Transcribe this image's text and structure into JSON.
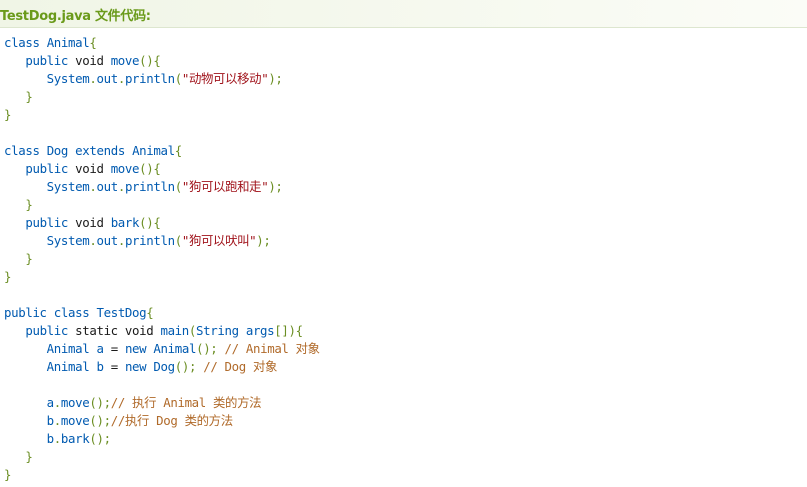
{
  "header": {
    "title": "TestDog.java 文件代码:"
  },
  "colors": {
    "keyword": "#005ab0",
    "plain": "#1a1a1a",
    "punctuation": "#6b8e23",
    "string": "#a0131b",
    "comment": "#b06a2a",
    "header_text": "#6a9a1a"
  },
  "code": {
    "lines": [
      [
        [
          "kw",
          "class"
        ],
        [
          "pl",
          " "
        ],
        [
          "kw",
          "Animal"
        ],
        [
          "pn",
          "{"
        ]
      ],
      [
        [
          "pl",
          "   "
        ],
        [
          "kw",
          "public"
        ],
        [
          "pl",
          " void "
        ],
        [
          "kw",
          "move"
        ],
        [
          "pn",
          "(){"
        ]
      ],
      [
        [
          "pl",
          "      "
        ],
        [
          "kw",
          "System"
        ],
        [
          "pn",
          "."
        ],
        [
          "kw",
          "out"
        ],
        [
          "pn",
          "."
        ],
        [
          "kw",
          "println"
        ],
        [
          "pn",
          "("
        ],
        [
          "st",
          "\"动物可以移动\""
        ],
        [
          "pn",
          ");"
        ]
      ],
      [
        [
          "pl",
          "   "
        ],
        [
          "pn",
          "}"
        ]
      ],
      [
        [
          "pn",
          "}"
        ]
      ],
      [],
      [
        [
          "kw",
          "class"
        ],
        [
          "pl",
          " "
        ],
        [
          "kw",
          "Dog"
        ],
        [
          "pl",
          " "
        ],
        [
          "kw",
          "extends"
        ],
        [
          "pl",
          " "
        ],
        [
          "kw",
          "Animal"
        ],
        [
          "pn",
          "{"
        ]
      ],
      [
        [
          "pl",
          "   "
        ],
        [
          "kw",
          "public"
        ],
        [
          "pl",
          " void "
        ],
        [
          "kw",
          "move"
        ],
        [
          "pn",
          "(){"
        ]
      ],
      [
        [
          "pl",
          "      "
        ],
        [
          "kw",
          "System"
        ],
        [
          "pn",
          "."
        ],
        [
          "kw",
          "out"
        ],
        [
          "pn",
          "."
        ],
        [
          "kw",
          "println"
        ],
        [
          "pn",
          "("
        ],
        [
          "st",
          "\"狗可以跑和走\""
        ],
        [
          "pn",
          ");"
        ]
      ],
      [
        [
          "pl",
          "   "
        ],
        [
          "pn",
          "}"
        ]
      ],
      [
        [
          "pl",
          "   "
        ],
        [
          "kw",
          "public"
        ],
        [
          "pl",
          " void "
        ],
        [
          "kw",
          "bark"
        ],
        [
          "pn",
          "(){"
        ]
      ],
      [
        [
          "pl",
          "      "
        ],
        [
          "kw",
          "System"
        ],
        [
          "pn",
          "."
        ],
        [
          "kw",
          "out"
        ],
        [
          "pn",
          "."
        ],
        [
          "kw",
          "println"
        ],
        [
          "pn",
          "("
        ],
        [
          "st",
          "\"狗可以吠叫\""
        ],
        [
          "pn",
          ");"
        ]
      ],
      [
        [
          "pl",
          "   "
        ],
        [
          "pn",
          "}"
        ]
      ],
      [
        [
          "pn",
          "}"
        ]
      ],
      [],
      [
        [
          "kw",
          "public"
        ],
        [
          "pl",
          " "
        ],
        [
          "kw",
          "class"
        ],
        [
          "pl",
          " "
        ],
        [
          "kw",
          "TestDog"
        ],
        [
          "pn",
          "{"
        ]
      ],
      [
        [
          "pl",
          "   "
        ],
        [
          "kw",
          "public"
        ],
        [
          "pl",
          " static void "
        ],
        [
          "kw",
          "main"
        ],
        [
          "pn",
          "("
        ],
        [
          "kw",
          "String"
        ],
        [
          "pl",
          " "
        ],
        [
          "kw",
          "args"
        ],
        [
          "pn",
          "[]){"
        ]
      ],
      [
        [
          "pl",
          "      "
        ],
        [
          "kw",
          "Animal"
        ],
        [
          "pl",
          " "
        ],
        [
          "kw",
          "a"
        ],
        [
          "pl",
          " = "
        ],
        [
          "kw",
          "new"
        ],
        [
          "pl",
          " "
        ],
        [
          "kw",
          "Animal"
        ],
        [
          "pn",
          "();"
        ],
        [
          "pl",
          " "
        ],
        [
          "cm",
          "// Animal 对象"
        ]
      ],
      [
        [
          "pl",
          "      "
        ],
        [
          "kw",
          "Animal"
        ],
        [
          "pl",
          " "
        ],
        [
          "kw",
          "b"
        ],
        [
          "pl",
          " = "
        ],
        [
          "kw",
          "new"
        ],
        [
          "pl",
          " "
        ],
        [
          "kw",
          "Dog"
        ],
        [
          "pn",
          "();"
        ],
        [
          "pl",
          " "
        ],
        [
          "cm",
          "// Dog 对象"
        ]
      ],
      [],
      [
        [
          "pl",
          "      "
        ],
        [
          "kw",
          "a"
        ],
        [
          "pn",
          "."
        ],
        [
          "kw",
          "move"
        ],
        [
          "pn",
          "();"
        ],
        [
          "cm",
          "// 执行 Animal 类的方法"
        ]
      ],
      [
        [
          "pl",
          "      "
        ],
        [
          "kw",
          "b"
        ],
        [
          "pn",
          "."
        ],
        [
          "kw",
          "move"
        ],
        [
          "pn",
          "();"
        ],
        [
          "cm",
          "//执行 Dog 类的方法"
        ]
      ],
      [
        [
          "pl",
          "      "
        ],
        [
          "kw",
          "b"
        ],
        [
          "pn",
          "."
        ],
        [
          "kw",
          "bark"
        ],
        [
          "pn",
          "();"
        ]
      ],
      [
        [
          "pl",
          "   "
        ],
        [
          "pn",
          "}"
        ]
      ],
      [
        [
          "pn",
          "}"
        ]
      ]
    ]
  }
}
